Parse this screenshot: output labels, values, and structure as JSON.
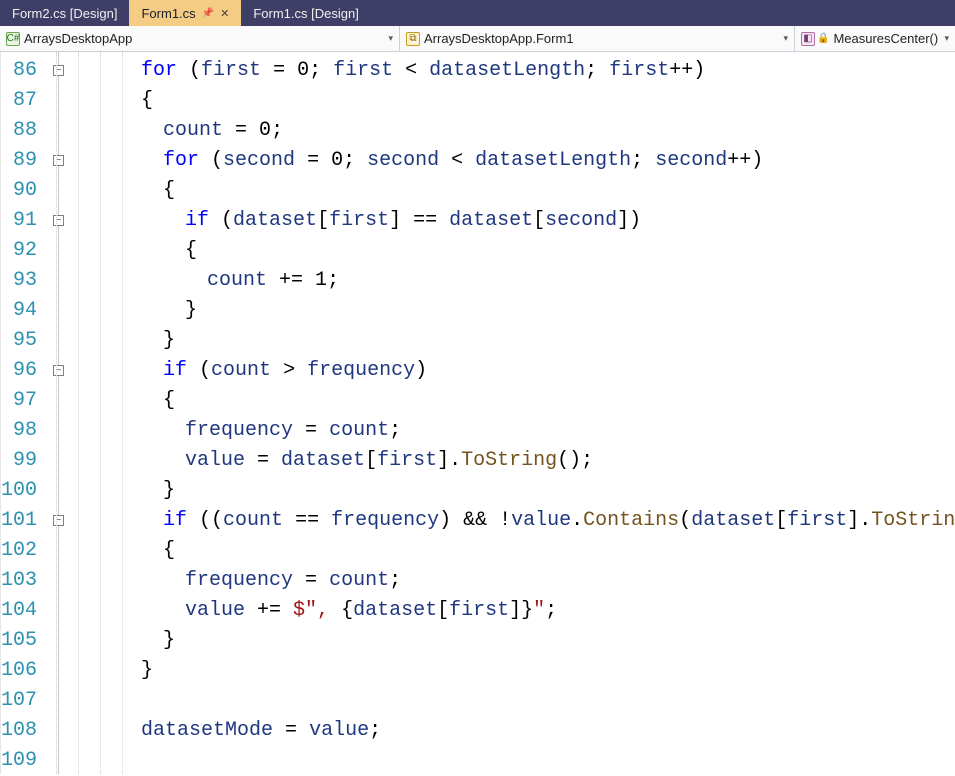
{
  "tabs": [
    {
      "label": "Form2.cs [Design]",
      "active": false
    },
    {
      "label": "Form1.cs",
      "active": true
    },
    {
      "label": "Form1.cs [Design]",
      "active": false
    }
  ],
  "nav": {
    "namespace": {
      "iconLetter": "C#",
      "label": "ArraysDesktopApp"
    },
    "class": {
      "label": "ArraysDesktopApp.Form1"
    },
    "member": {
      "label": "MeasuresCenter()"
    }
  },
  "lines": [
    {
      "n": 86,
      "indent": 4,
      "fold": true,
      "tokens": [
        {
          "t": "for",
          "c": "kw"
        },
        {
          "t": " ("
        },
        {
          "t": "first",
          "c": "ident"
        },
        {
          "t": " = "
        },
        {
          "t": "0",
          "c": "num"
        },
        {
          "t": "; "
        },
        {
          "t": "first",
          "c": "ident"
        },
        {
          "t": " < "
        },
        {
          "t": "datasetLength",
          "c": "ident"
        },
        {
          "t": "; "
        },
        {
          "t": "first",
          "c": "ident"
        },
        {
          "t": "++)"
        }
      ]
    },
    {
      "n": 87,
      "indent": 4,
      "tokens": [
        {
          "t": "{"
        }
      ]
    },
    {
      "n": 88,
      "indent": 5,
      "tokens": [
        {
          "t": "count",
          "c": "ident"
        },
        {
          "t": " = "
        },
        {
          "t": "0",
          "c": "num"
        },
        {
          "t": ";"
        }
      ]
    },
    {
      "n": 89,
      "indent": 5,
      "fold": true,
      "tokens": [
        {
          "t": "for",
          "c": "kw"
        },
        {
          "t": " ("
        },
        {
          "t": "second",
          "c": "ident"
        },
        {
          "t": " = "
        },
        {
          "t": "0",
          "c": "num"
        },
        {
          "t": "; "
        },
        {
          "t": "second",
          "c": "ident"
        },
        {
          "t": " < "
        },
        {
          "t": "datasetLength",
          "c": "ident"
        },
        {
          "t": "; "
        },
        {
          "t": "second",
          "c": "ident"
        },
        {
          "t": "++)"
        }
      ]
    },
    {
      "n": 90,
      "indent": 5,
      "tokens": [
        {
          "t": "{"
        }
      ]
    },
    {
      "n": 91,
      "indent": 6,
      "fold": true,
      "tokens": [
        {
          "t": "if",
          "c": "kw"
        },
        {
          "t": " ("
        },
        {
          "t": "dataset",
          "c": "ident"
        },
        {
          "t": "["
        },
        {
          "t": "first",
          "c": "ident"
        },
        {
          "t": "] == "
        },
        {
          "t": "dataset",
          "c": "ident"
        },
        {
          "t": "["
        },
        {
          "t": "second",
          "c": "ident"
        },
        {
          "t": "])"
        }
      ]
    },
    {
      "n": 92,
      "indent": 6,
      "tokens": [
        {
          "t": "{"
        }
      ]
    },
    {
      "n": 93,
      "indent": 7,
      "tokens": [
        {
          "t": "count",
          "c": "ident"
        },
        {
          "t": " += "
        },
        {
          "t": "1",
          "c": "num"
        },
        {
          "t": ";"
        }
      ]
    },
    {
      "n": 94,
      "indent": 6,
      "tokens": [
        {
          "t": "}"
        }
      ]
    },
    {
      "n": 95,
      "indent": 5,
      "tokens": [
        {
          "t": "}"
        }
      ]
    },
    {
      "n": 96,
      "indent": 5,
      "fold": true,
      "tokens": [
        {
          "t": "if",
          "c": "kw"
        },
        {
          "t": " ("
        },
        {
          "t": "count",
          "c": "ident"
        },
        {
          "t": " > "
        },
        {
          "t": "frequency",
          "c": "ident"
        },
        {
          "t": ")"
        }
      ]
    },
    {
      "n": 97,
      "indent": 5,
      "tokens": [
        {
          "t": "{"
        }
      ]
    },
    {
      "n": 98,
      "indent": 6,
      "tokens": [
        {
          "t": "frequency",
          "c": "ident"
        },
        {
          "t": " = "
        },
        {
          "t": "count",
          "c": "ident"
        },
        {
          "t": ";"
        }
      ]
    },
    {
      "n": 99,
      "indent": 6,
      "tokens": [
        {
          "t": "value",
          "c": "ident"
        },
        {
          "t": " = "
        },
        {
          "t": "dataset",
          "c": "ident"
        },
        {
          "t": "["
        },
        {
          "t": "first",
          "c": "ident"
        },
        {
          "t": "]."
        },
        {
          "t": "ToString",
          "c": "method"
        },
        {
          "t": "();"
        }
      ]
    },
    {
      "n": 100,
      "indent": 5,
      "tokens": [
        {
          "t": "}"
        }
      ]
    },
    {
      "n": 101,
      "indent": 5,
      "fold": true,
      "tokens": [
        {
          "t": "if",
          "c": "kw"
        },
        {
          "t": " (("
        },
        {
          "t": "count",
          "c": "ident"
        },
        {
          "t": " == "
        },
        {
          "t": "frequency",
          "c": "ident"
        },
        {
          "t": ") && !"
        },
        {
          "t": "value",
          "c": "ident"
        },
        {
          "t": "."
        },
        {
          "t": "Contains",
          "c": "method"
        },
        {
          "t": "("
        },
        {
          "t": "dataset",
          "c": "ident"
        },
        {
          "t": "["
        },
        {
          "t": "first",
          "c": "ident"
        },
        {
          "t": "]."
        },
        {
          "t": "ToString",
          "c": "method"
        },
        {
          "t": "()))"
        }
      ]
    },
    {
      "n": 102,
      "indent": 5,
      "tokens": [
        {
          "t": "{"
        }
      ]
    },
    {
      "n": 103,
      "indent": 6,
      "tokens": [
        {
          "t": "frequency",
          "c": "ident"
        },
        {
          "t": " = "
        },
        {
          "t": "count",
          "c": "ident"
        },
        {
          "t": ";"
        }
      ]
    },
    {
      "n": 104,
      "indent": 6,
      "tokens": [
        {
          "t": "value",
          "c": "ident"
        },
        {
          "t": " += "
        },
        {
          "t": "$\", ",
          "c": "str"
        },
        {
          "t": "{"
        },
        {
          "t": "dataset",
          "c": "ident"
        },
        {
          "t": "["
        },
        {
          "t": "first",
          "c": "ident"
        },
        {
          "t": "]"
        },
        {
          "t": "}"
        },
        {
          "t": "\"",
          "c": "str"
        },
        {
          "t": ";"
        }
      ]
    },
    {
      "n": 105,
      "indent": 5,
      "tokens": [
        {
          "t": "}"
        }
      ]
    },
    {
      "n": 106,
      "indent": 4,
      "tokens": [
        {
          "t": "}"
        }
      ]
    },
    {
      "n": 107,
      "indent": 0,
      "tokens": []
    },
    {
      "n": 108,
      "indent": 4,
      "tokens": [
        {
          "t": "datasetMode",
          "c": "ident"
        },
        {
          "t": " = "
        },
        {
          "t": "value",
          "c": "ident"
        },
        {
          "t": ";"
        }
      ]
    },
    {
      "n": 109,
      "indent": 0,
      "tokens": []
    }
  ],
  "guideColumns": [
    0,
    1,
    2,
    3
  ],
  "charWidth": 11,
  "indentUnitPx": 22,
  "baseIndentPx": 0
}
